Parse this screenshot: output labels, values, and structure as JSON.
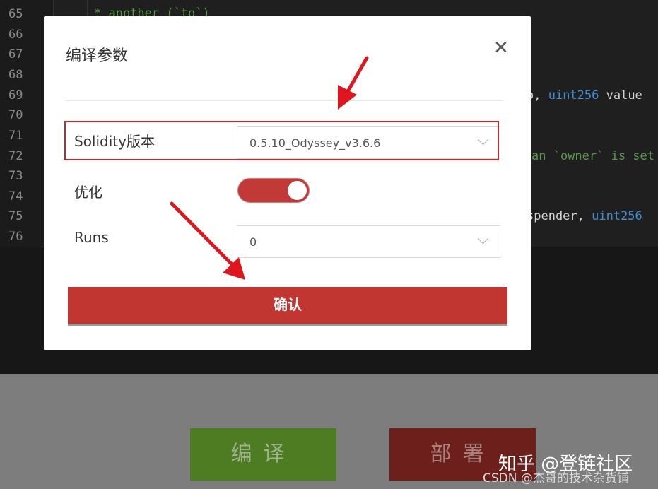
{
  "editor": {
    "line_numbers": [
      "65",
      "66",
      "67",
      "68",
      "69",
      "70",
      "71",
      "72",
      "73",
      "74",
      "75",
      "76"
    ],
    "line65_comment": "* another (`to`)",
    "frag69_pre": "o, ",
    "frag69_kw": "uint256",
    "frag69_post": " value",
    "frag72_comment": "an `owner` is set",
    "frag75_pre": "spender, ",
    "frag75_kw": "uint256"
  },
  "footer": {
    "compile_label": "编译",
    "deploy_label": "部署",
    "watermark": "知乎 @登链社区",
    "csdn_credit": "CSDN @杰哥的技术杂货铺"
  },
  "modal": {
    "title": "编译参数",
    "close_icon": "close-icon",
    "solidity_label": "Solidity版本",
    "solidity_value": "0.5.10_Odyssey_v3.6.6",
    "optimize_label": "优化",
    "optimize_on": true,
    "runs_label": "Runs",
    "runs_value": "0",
    "confirm_label": "确认"
  },
  "colors": {
    "accent_red": "#c23632",
    "compile_green": "#4e7c23",
    "deploy_red": "#6d1f1c",
    "annotation_red": "#e0161e"
  }
}
